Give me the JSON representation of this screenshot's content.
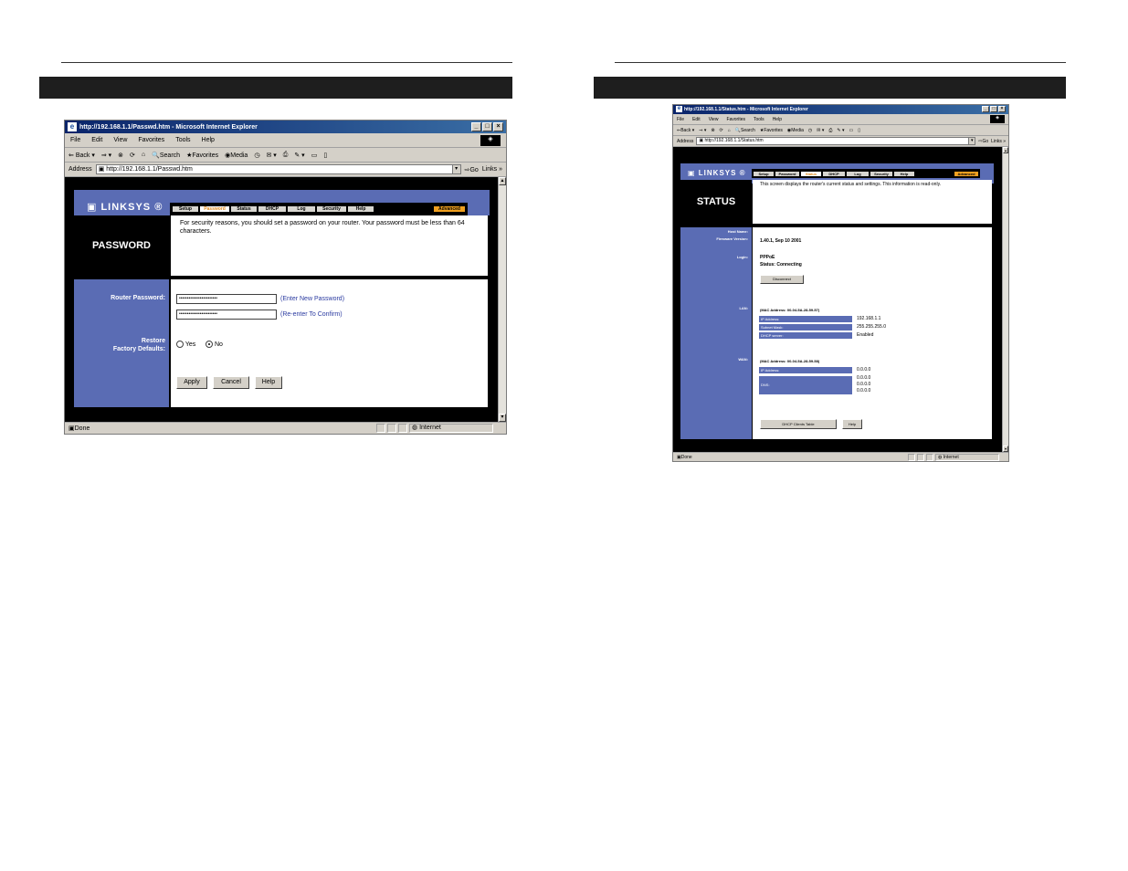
{
  "shot1": {
    "title": "http://192.168.1.1/Passwd.htm - Microsoft Internet Explorer",
    "menu": [
      "File",
      "Edit",
      "View",
      "Favorites",
      "Tools",
      "Help"
    ],
    "toolbar": [
      "Back",
      "Search",
      "Favorites",
      "Media"
    ],
    "address_label": "Address",
    "address": "http://192.168.1.1/Passwd.htm",
    "go": "Go",
    "links": "Links",
    "logo": "LINKSYS",
    "tabs": [
      "Setup",
      "Password",
      "Status",
      "DHCP",
      "Log",
      "Security",
      "Help",
      "Advanced"
    ],
    "page_title": "PASSWORD",
    "description": "For security reasons, you should set a password on your router. Your password must be less than 64 characters.",
    "router_password_label": "Router Password:",
    "password_value": "••••••••••••••••••••••••",
    "confirm_value": "••••••••••••••••••••••••",
    "enter_hint": "(Enter New Password)",
    "confirm_hint": "(Re-enter To Confirm)",
    "restore_label": "Restore",
    "factory_label": "Factory Defaults:",
    "yes": "Yes",
    "no": "No",
    "apply": "Apply",
    "cancel": "Cancel",
    "help": "Help",
    "status": "Done",
    "zone": "Internet"
  },
  "shot2": {
    "title": "http://192.168.1.1/Status.htm - Microsoft Internet Explorer",
    "menu": [
      "File",
      "Edit",
      "View",
      "Favorites",
      "Tools",
      "Help"
    ],
    "toolbar": [
      "Back",
      "Search",
      "Favorites",
      "Media"
    ],
    "address_label": "Address",
    "address": "http://192.168.1.1/Status.htm",
    "go": "Go",
    "links": "Links",
    "logo": "LINKSYS",
    "tabs": [
      "Setup",
      "Password",
      "Status",
      "DHCP",
      "Log",
      "Security",
      "Help",
      "Advanced"
    ],
    "page_title": "STATUS",
    "description": "This screen displays the router's current status and settings. This information is read-only.",
    "host_name_label": "Host Name:",
    "firmware_label": "Firmware Version:",
    "firmware_value": "1.40.1, Sep 10 2001",
    "login_label": "Login:",
    "login_value": "PPPoE",
    "login_status": "Status: Connecting",
    "disconnect": "Disconnect",
    "lan_label": "LAN:",
    "lan_mac": "(MAC Address: 00-04-5A-28-59-57)",
    "lan_rows": [
      {
        "label": "IP Address:",
        "value": "192.168.1.1"
      },
      {
        "label": "Subnet Mask:",
        "value": "255.255.255.0"
      },
      {
        "label": "DHCP server:",
        "value": "Enabled"
      }
    ],
    "wan_label": "WAN:",
    "wan_mac": "(MAC Address: 00-04-5A-28-59-58)",
    "wan_ip_label": "IP Address:",
    "wan_ip_value": "0.0.0.0",
    "dns_label": "DNS:",
    "dns_values": [
      "0.0.0.0",
      "0.0.0.0",
      "0.0.0.0"
    ],
    "dhcp_clients": "DHCP Clients Table",
    "help": "Help",
    "status": "Done",
    "zone": "Internet"
  }
}
